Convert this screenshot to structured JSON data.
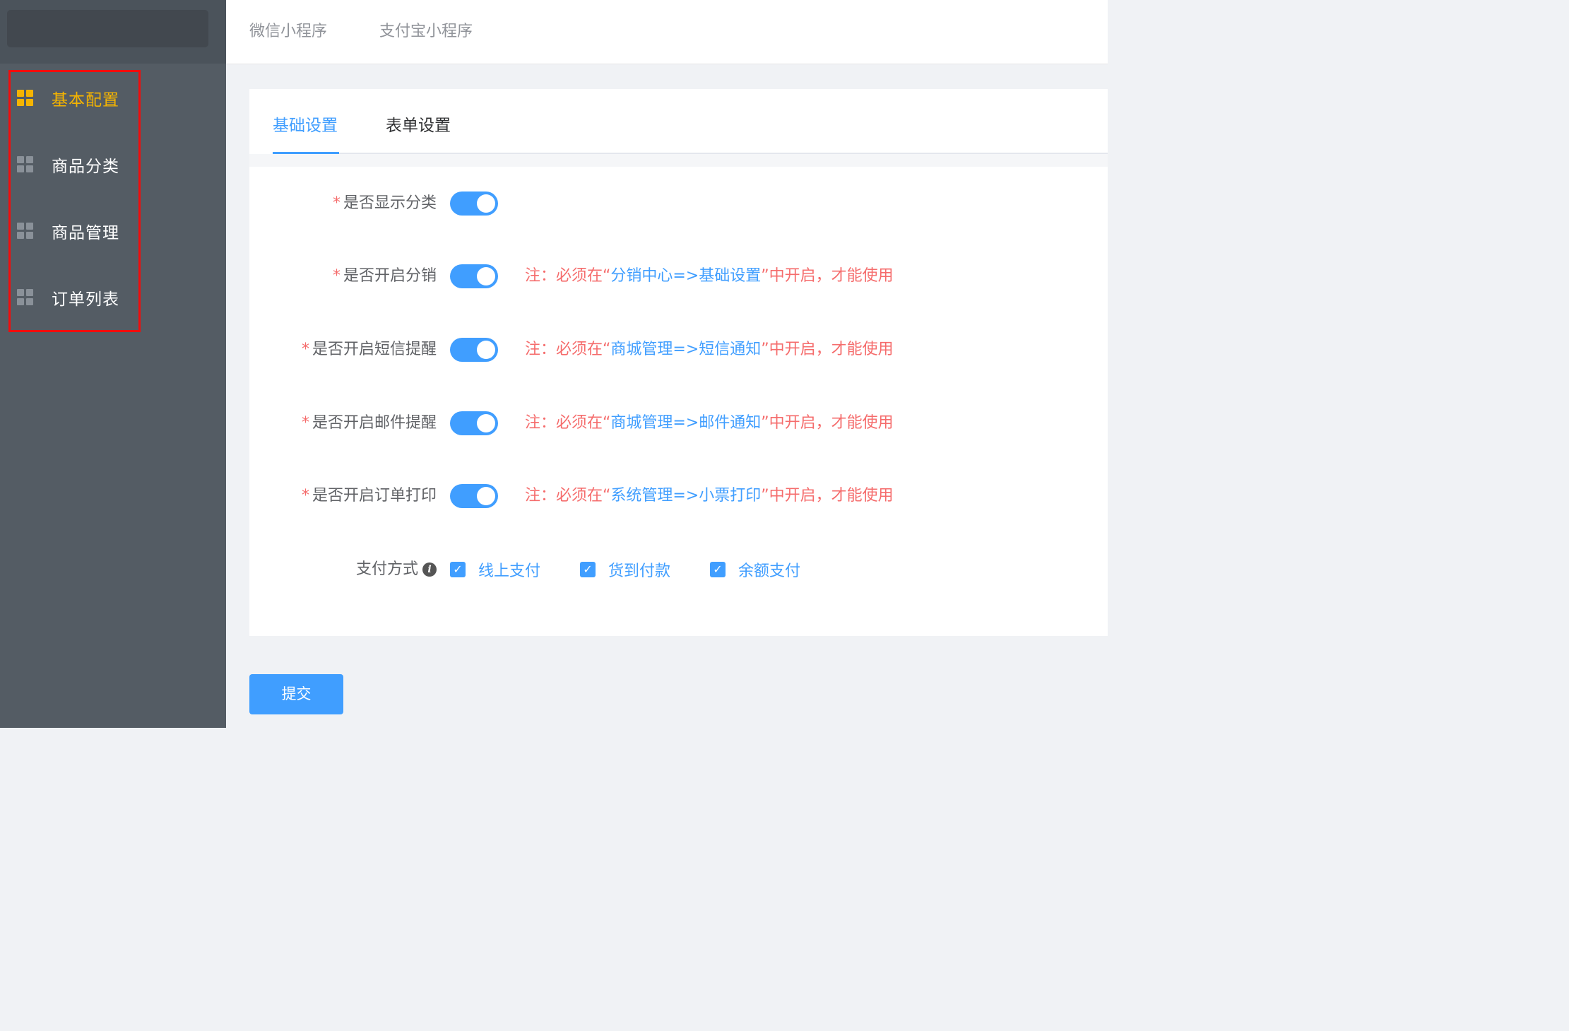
{
  "top_tabs": [
    "微信小程序",
    "支付宝小程序"
  ],
  "sidebar": {
    "items": [
      {
        "label": "基本配置",
        "active": true
      },
      {
        "label": "商品分类",
        "active": false
      },
      {
        "label": "商品管理",
        "active": false
      },
      {
        "label": "订单列表",
        "active": false
      }
    ]
  },
  "card_tabs": [
    "基础设置",
    "表单设置"
  ],
  "form": {
    "rows": [
      {
        "required": "*",
        "label": "是否显示分类",
        "switch_on": true
      },
      {
        "required": "*",
        "label": "是否开启分销",
        "switch_on": true,
        "note": {
          "prefix": "注：必须在“",
          "link": "分销中心=>基础设置",
          "suffix": "”中开启，才能使用"
        }
      },
      {
        "required": "*",
        "label": "是否开启短信提醒",
        "switch_on": true,
        "note": {
          "prefix": "注：必须在“",
          "link": "商城管理=>短信通知",
          "suffix": "”中开启，才能使用"
        }
      },
      {
        "required": "*",
        "label": "是否开启邮件提醒",
        "switch_on": true,
        "note": {
          "prefix": "注：必须在“",
          "link": "商城管理=>邮件通知",
          "suffix": "”中开启，才能使用"
        }
      },
      {
        "required": "*",
        "label": "是否开启订单打印",
        "switch_on": true,
        "note": {
          "prefix": "注：必须在“",
          "link": "系统管理=>小票打印",
          "suffix": "”中开启，才能使用"
        }
      }
    ],
    "payment": {
      "label": "支付方式",
      "info_glyph": "i",
      "options": [
        {
          "label": "线上支付",
          "checked": true
        },
        {
          "label": "货到付款",
          "checked": true
        },
        {
          "label": "余额支付",
          "checked": true
        }
      ]
    }
  },
  "submit_label": "提交",
  "colors": {
    "sidebar_bg": "#545c64",
    "active_menu": "#f5b400",
    "primary": "#409eff",
    "danger": "#f56c6c",
    "highlight_frame": "#f20c0c"
  }
}
